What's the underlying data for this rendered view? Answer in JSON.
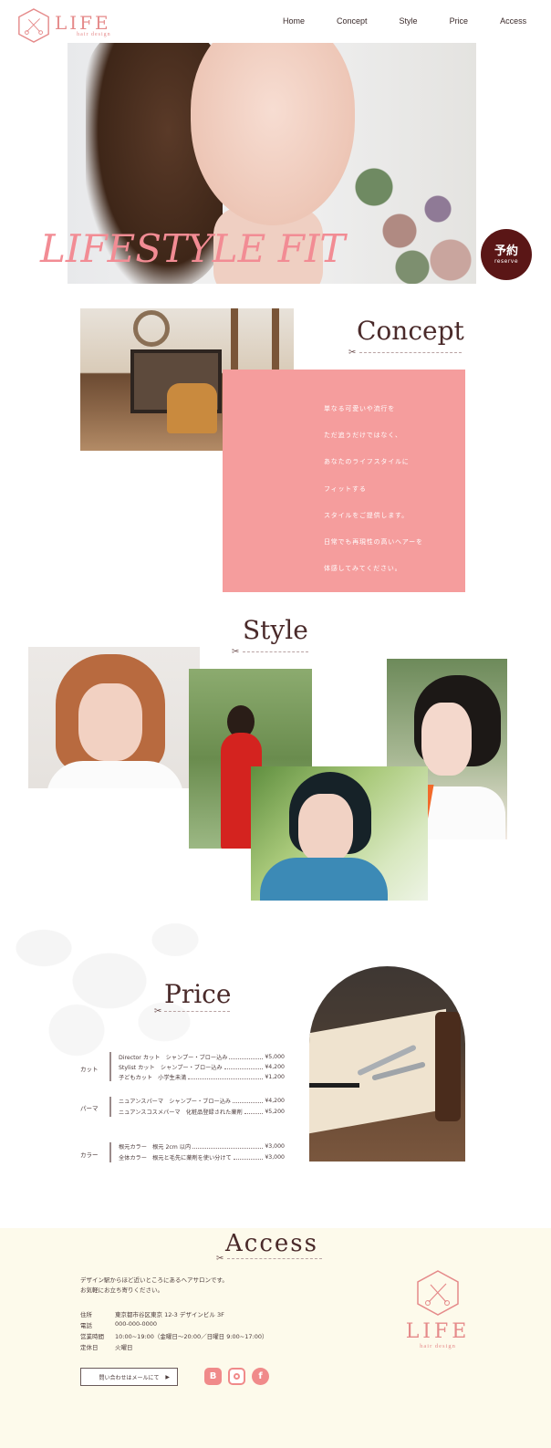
{
  "brand": {
    "name": "LIFE",
    "sub": "hair design"
  },
  "nav": [
    "Home",
    "Concept",
    "Style",
    "Price",
    "Access"
  ],
  "hero": {
    "title": "LIFESTYLE FIT"
  },
  "reserve": {
    "jp": "予約",
    "en": "reserve"
  },
  "concept": {
    "heading": "Concept",
    "lines": [
      "単なる可愛いや流行を",
      "ただ追うだけではなく、",
      "あなたのライフスタイルに",
      "フィットする",
      "スタイルをご提供します。",
      "日常でも再現性の高いヘアーを",
      "体感してみてください。"
    ]
  },
  "style": {
    "heading": "Style"
  },
  "price": {
    "heading": "Price",
    "groups": [
      {
        "category": "カット",
        "items": [
          {
            "name": "Director カット　シャンプー・ブロー込み",
            "price": "¥5,000"
          },
          {
            "name": "Stylist カット　シャンプー・ブロー込み",
            "price": "¥4,200"
          },
          {
            "name": "子どもカット　小学生未満",
            "price": "¥1,200"
          }
        ]
      },
      {
        "category": "パーマ",
        "items": [
          {
            "name": "ニュアンスパーマ　シャンプー・ブロー込み",
            "price": "¥4,200"
          },
          {
            "name": "ニュアンスコスメパーマ　化粧品登録された薬剤",
            "price": "¥5,200"
          }
        ]
      },
      {
        "category": "カラー",
        "items": [
          {
            "name": "根元カラー　根元 2cm 以内",
            "price": "¥3,000"
          },
          {
            "name": "全体カラー　根元と毛先に薬剤を使い分けて",
            "price": "¥3,000"
          }
        ]
      }
    ]
  },
  "access": {
    "heading": "Access",
    "intro": [
      "デザイン駅からほど近いところにあるヘアサロンです。",
      "お気軽にお立ち寄りください。"
    ],
    "info": [
      {
        "key": "住所",
        "value": "東京都市谷区東京 12-3 デザインビル 3F"
      },
      {
        "key": "電話",
        "value": "000-000-0000"
      },
      {
        "key": "営業時間",
        "value": "10:00~19:00（金曜日～20:00／日曜日 9:00~17:00）"
      },
      {
        "key": "定休日",
        "value": "火曜日"
      }
    ],
    "contact_button": "問い合わせはメールにて",
    "contact_arrow": "▶"
  },
  "colors": {
    "accent": "#f59d9d",
    "brand": "#e58a8a",
    "dark": "#5a1616",
    "access_bg": "#fdfaeb"
  },
  "icons": [
    "scissors-icon",
    "logo-hex-icon",
    "booking-b-icon",
    "instagram-icon",
    "facebook-icon"
  ]
}
